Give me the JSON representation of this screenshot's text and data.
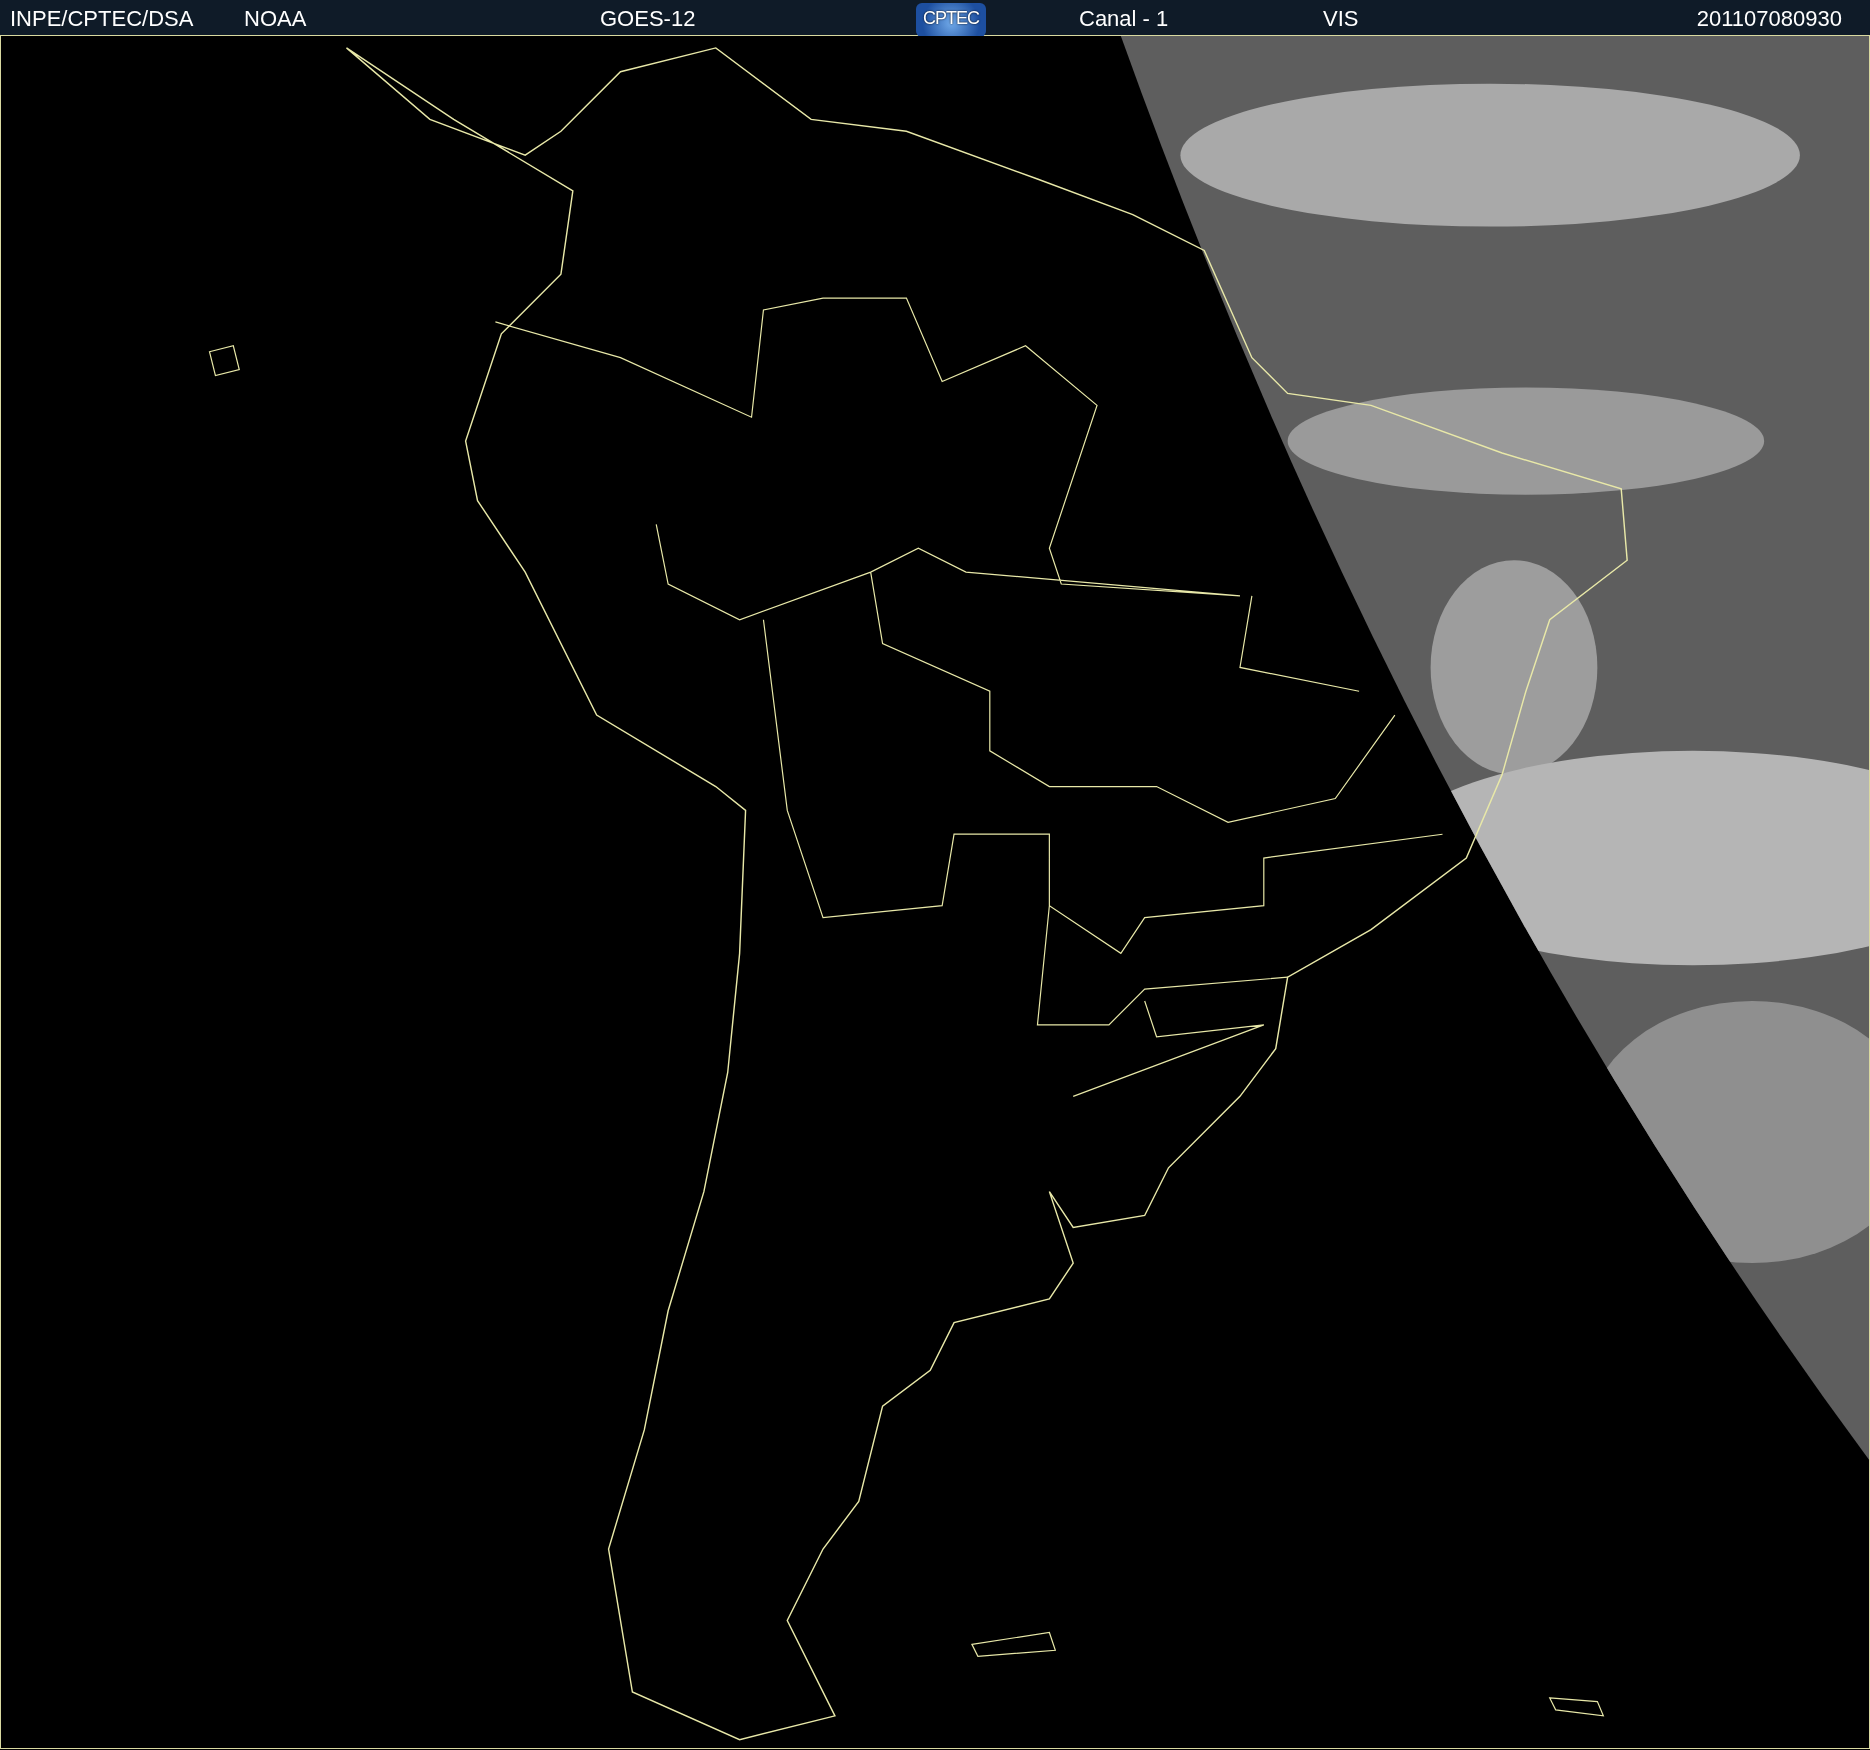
{
  "header": {
    "items": [
      {
        "kind": "text",
        "text": "INPE/CPTEC/DSA"
      },
      {
        "kind": "text",
        "text": "NOAA"
      },
      {
        "kind": "text",
        "text": "GOES-12"
      },
      {
        "kind": "logo",
        "text": "CPTEC"
      },
      {
        "kind": "text",
        "text": "Canal - 1"
      },
      {
        "kind": "text",
        "text": "VIS"
      },
      {
        "kind": "text",
        "text": "201107080930"
      }
    ]
  }
}
